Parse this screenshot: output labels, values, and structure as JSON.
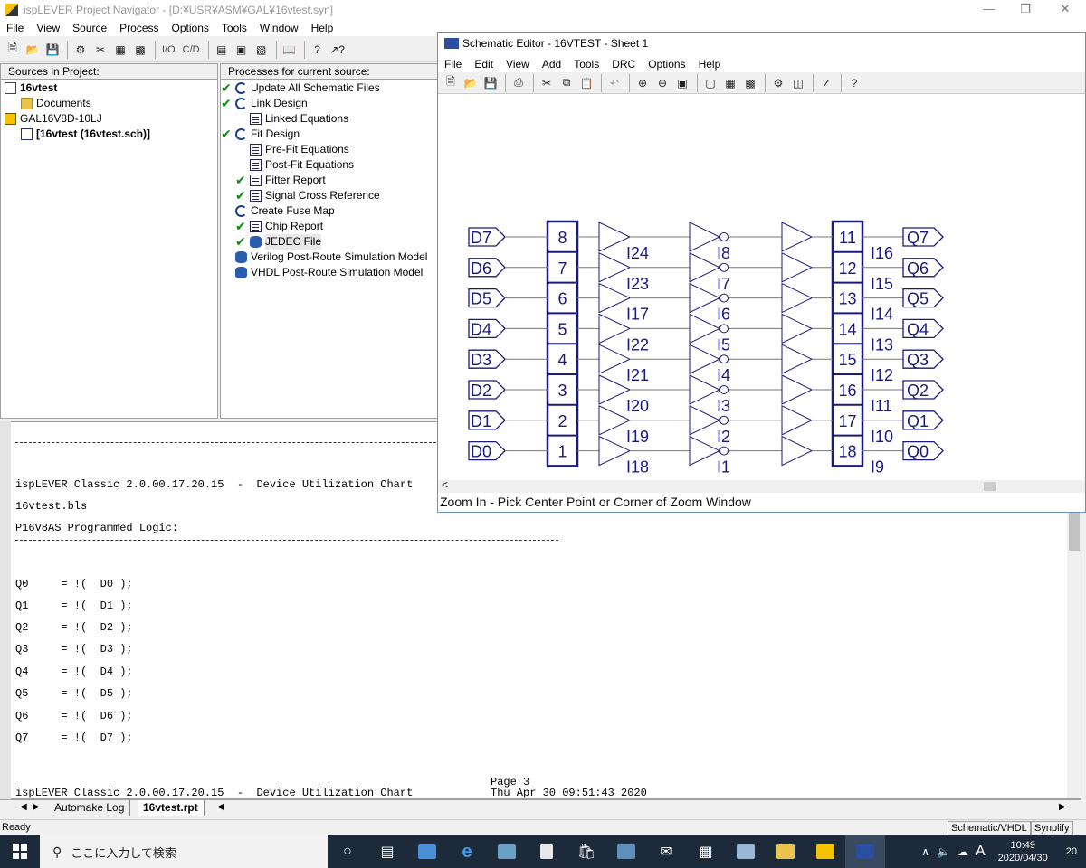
{
  "main_window": {
    "title": "ispLEVER Project Navigator - [D:¥USR¥ASM¥GAL¥16vtest.syn]",
    "menu": [
      "File",
      "View",
      "Source",
      "Process",
      "Options",
      "Tools",
      "Window",
      "Help"
    ],
    "toolbar_text": {
      "io": "I/O",
      "cd": "C/D"
    }
  },
  "sources_pane": {
    "header": "Sources in Project:",
    "items": [
      {
        "label": "16vtest"
      },
      {
        "label": "Documents"
      },
      {
        "label": "GAL16V8D-10LJ"
      },
      {
        "label": "[16vtest (16vtest.sch)]"
      }
    ]
  },
  "processes_pane": {
    "header": "Processes for current source:",
    "items": [
      {
        "label": "Update All Schematic Files",
        "checked": true
      },
      {
        "label": "Link Design",
        "checked": true
      },
      {
        "label": "Linked Equations",
        "checked": false
      },
      {
        "label": "Fit Design",
        "checked": true
      },
      {
        "label": "Pre-Fit Equations",
        "checked": false
      },
      {
        "label": "Post-Fit Equations",
        "checked": false
      },
      {
        "label": "Fitter Report",
        "checked": true
      },
      {
        "label": "Signal Cross Reference",
        "checked": true
      },
      {
        "label": "Create Fuse Map",
        "checked": false
      },
      {
        "label": "Chip Report",
        "checked": true
      },
      {
        "label": "JEDEC File",
        "checked": true
      },
      {
        "label": "Verilog Post-Route Simulation Model",
        "checked": false
      },
      {
        "label": "VHDL Post-Route Simulation Model",
        "checked": false
      }
    ]
  },
  "report": {
    "header_line": "ispLEVER Classic 2.0.00.17.20.15  -  Device Utilization Chart",
    "file": "16vtest.bls",
    "section": "P16V8AS Programmed Logic:",
    "equations": [
      "Q0     = !(  D0 );",
      "Q1     = !(  D1 );",
      "Q2     = !(  D2 );",
      "Q3     = !(  D3 );",
      "Q4     = !(  D4 );",
      "Q5     = !(  D5 );",
      "Q6     = !(  D6 );",
      "Q7     = !(  D7 );"
    ],
    "page": "Page 3",
    "date": "Thu Apr 30 09:51:43 2020"
  },
  "tabs": [
    "Automake Log",
    "16vtest.rpt"
  ],
  "status": {
    "left": "Ready",
    "panel1": "Schematic/VHDL",
    "panel2": "Synplify"
  },
  "schematic_editor": {
    "title": "Schematic Editor - 16VTEST - Sheet 1",
    "menu": [
      "File",
      "Edit",
      "View",
      "Add",
      "Tools",
      "DRC",
      "Options",
      "Help"
    ],
    "status_line": "Zoom In - Pick Center Point or Corner of Zoom Window",
    "scroll_left_glyph": "<",
    "rows": [
      {
        "input": "D7",
        "in_pin": "8",
        "buf_label": "I24",
        "inv_label": "I8",
        "out_pin": "11",
        "out_buf": "I16",
        "output": "Q7"
      },
      {
        "input": "D6",
        "in_pin": "7",
        "buf_label": "I23",
        "inv_label": "I7",
        "out_pin": "12",
        "out_buf": "I15",
        "output": "Q6"
      },
      {
        "input": "D5",
        "in_pin": "6",
        "buf_label": "I17",
        "inv_label": "I6",
        "out_pin": "13",
        "out_buf": "I14",
        "output": "Q5"
      },
      {
        "input": "D4",
        "in_pin": "5",
        "buf_label": "I22",
        "inv_label": "I5",
        "out_pin": "14",
        "out_buf": "I13",
        "output": "Q4"
      },
      {
        "input": "D3",
        "in_pin": "4",
        "buf_label": "I21",
        "inv_label": "I4",
        "out_pin": "15",
        "out_buf": "I12",
        "output": "Q3"
      },
      {
        "input": "D2",
        "in_pin": "3",
        "buf_label": "I20",
        "inv_label": "I3",
        "out_pin": "16",
        "out_buf": "I11",
        "output": "Q2"
      },
      {
        "input": "D1",
        "in_pin": "2",
        "buf_label": "I19",
        "inv_label": "I2",
        "out_pin": "17",
        "out_buf": "I10",
        "output": "Q1"
      },
      {
        "input": "D0",
        "in_pin": "1",
        "buf_label": "I18",
        "inv_label": "I1",
        "out_pin": "18",
        "out_buf": "I9",
        "output": "Q0"
      }
    ]
  },
  "taskbar": {
    "search_placeholder": "ここに入力して検索",
    "time": "10:49",
    "date": "2020/04/30",
    "ime": "A",
    "notifications": "20"
  },
  "colors": {
    "schematic": "#1a1a7a",
    "wire": "#777777",
    "check": "#118a11"
  }
}
